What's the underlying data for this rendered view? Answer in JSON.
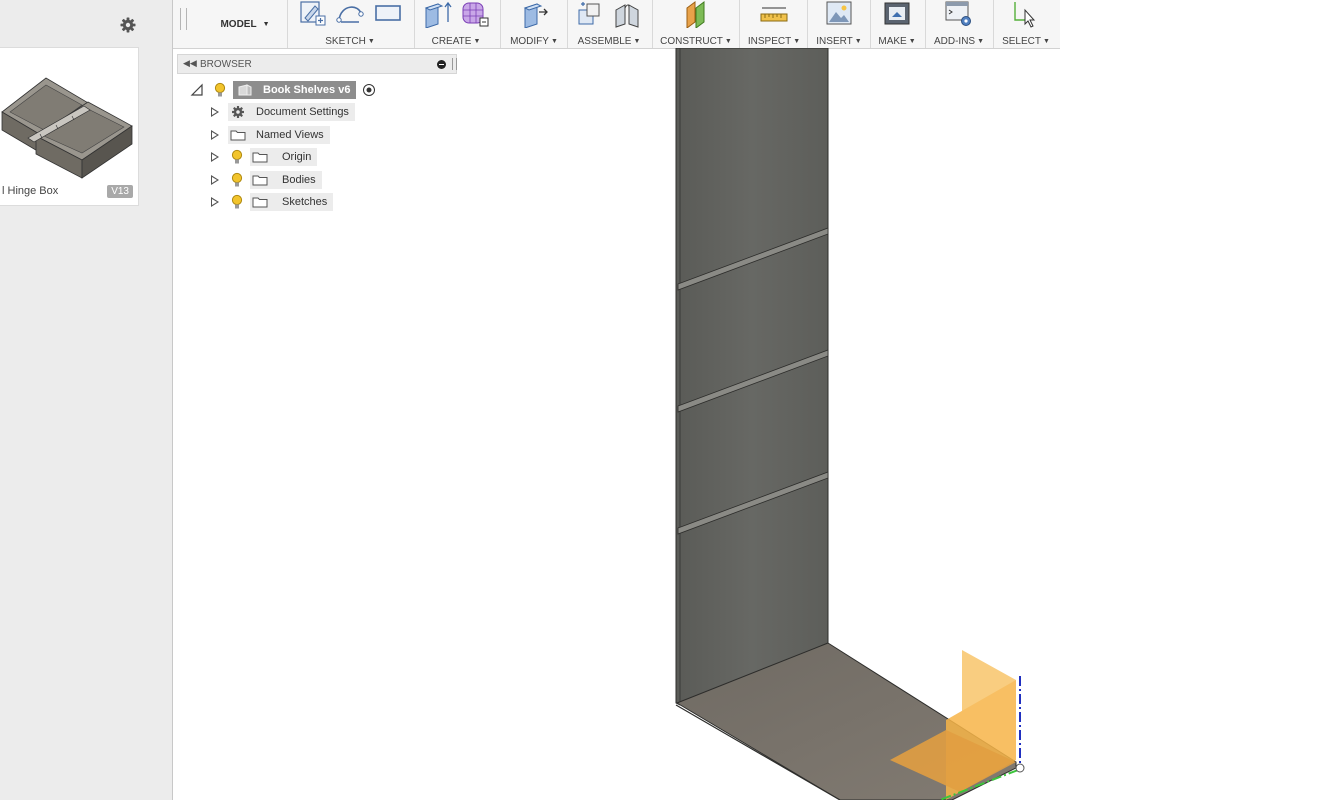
{
  "data_panel": {
    "thumbnail": {
      "name": "l Hinge Box",
      "version": "V13"
    },
    "icons": {
      "settings": "gear-icon"
    }
  },
  "toolbar": {
    "workspace": "MODEL",
    "groups": [
      {
        "label": "SKETCH"
      },
      {
        "label": "CREATE"
      },
      {
        "label": "MODIFY"
      },
      {
        "label": "ASSEMBLE"
      },
      {
        "label": "CONSTRUCT"
      },
      {
        "label": "INSPECT"
      },
      {
        "label": "INSERT"
      },
      {
        "label": "MAKE"
      },
      {
        "label": "ADD-INS"
      },
      {
        "label": "SELECT"
      }
    ]
  },
  "browser": {
    "title": "BROWSER",
    "root": "Book Shelves v6",
    "items": [
      {
        "label": "Document Settings",
        "icon": "gear-icon"
      },
      {
        "label": "Named Views",
        "icon": "folder-icon"
      },
      {
        "label": "Origin",
        "icon": "folder-icon",
        "visibility": "lightbulb-icon"
      },
      {
        "label": "Bodies",
        "icon": "folder-icon",
        "visibility": "lightbulb-icon"
      },
      {
        "label": "Sketches",
        "icon": "folder-icon",
        "visibility": "lightbulb-icon"
      }
    ]
  },
  "colors": {
    "panel_bg": "#ececec",
    "toolbar_bg": "#f6f6f6",
    "body_side": "#5f605c",
    "body_floor": "#77716a",
    "origin_plane": "#f7b548",
    "axis_green": "#3cc53c",
    "axis_blue": "#2030c0",
    "lightbulb": "#f2c42c"
  }
}
